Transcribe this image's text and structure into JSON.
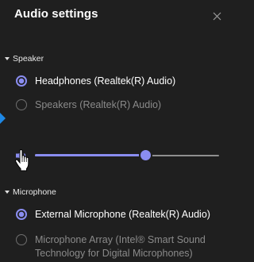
{
  "dialog": {
    "title": "Audio settings",
    "close_icon": "close-icon"
  },
  "speaker": {
    "section_label": "Speaker",
    "options": [
      {
        "label": "Headphones (Realtek(R) Audio)",
        "selected": true
      },
      {
        "label": "Speakers (Realtek(R) Audio)",
        "selected": false
      }
    ],
    "volume_icon": "speaker-volume-icon",
    "volume_level": 0.6
  },
  "microphone": {
    "section_label": "Microphone",
    "options": [
      {
        "label": "External Microphone (Realtek(R) Audio)",
        "selected": true
      },
      {
        "label": "Microphone Array (Intel® Smart Sound Technology for Digital Microphones)",
        "selected": false
      }
    ]
  },
  "colors": {
    "accent": "#8a8df0",
    "background": "#1f1f1f",
    "edge_marker": "#1e88e5"
  }
}
